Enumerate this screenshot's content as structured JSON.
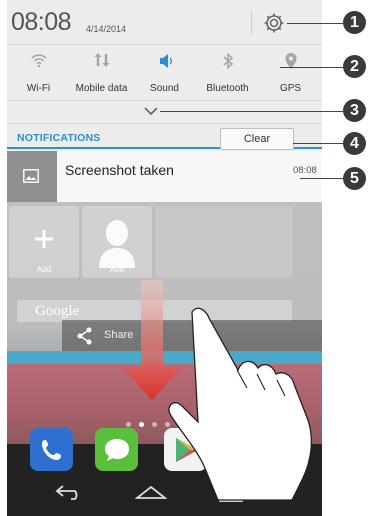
{
  "status": {
    "time": "08:08",
    "date": "4/14/2014"
  },
  "toggles": [
    {
      "label": "Wi-Fi",
      "icon": "wifi-icon",
      "active": false
    },
    {
      "label": "Mobile data",
      "icon": "mobile-data-icon",
      "active": false
    },
    {
      "label": "Sound",
      "icon": "sound-icon",
      "active": true
    },
    {
      "label": "Bluetooth",
      "icon": "bluetooth-icon",
      "active": false
    },
    {
      "label": "GPS",
      "icon": "gps-icon",
      "active": false
    }
  ],
  "notifications": {
    "header": "NOTIFICATIONS",
    "clear_label": "Clear",
    "items": [
      {
        "title": "Screenshot taken",
        "time": "08:08",
        "icon": "image-icon"
      }
    ]
  },
  "home": {
    "tiles": [
      {
        "label": "Add"
      },
      {
        "label": "Add"
      }
    ],
    "search_text": "Google",
    "share_label": "Share",
    "apps": [
      "phone-icon",
      "messaging-icon",
      "play-store-icon"
    ],
    "nav": [
      "back-icon",
      "home-icon",
      "recents-icon"
    ]
  },
  "callouts": [
    "1",
    "2",
    "3",
    "4",
    "5"
  ],
  "colors": {
    "accent": "#2c8fd1",
    "sound_active": "#2c8fd1",
    "arrow": "#d9302a",
    "callout": "#3a3a3a"
  }
}
